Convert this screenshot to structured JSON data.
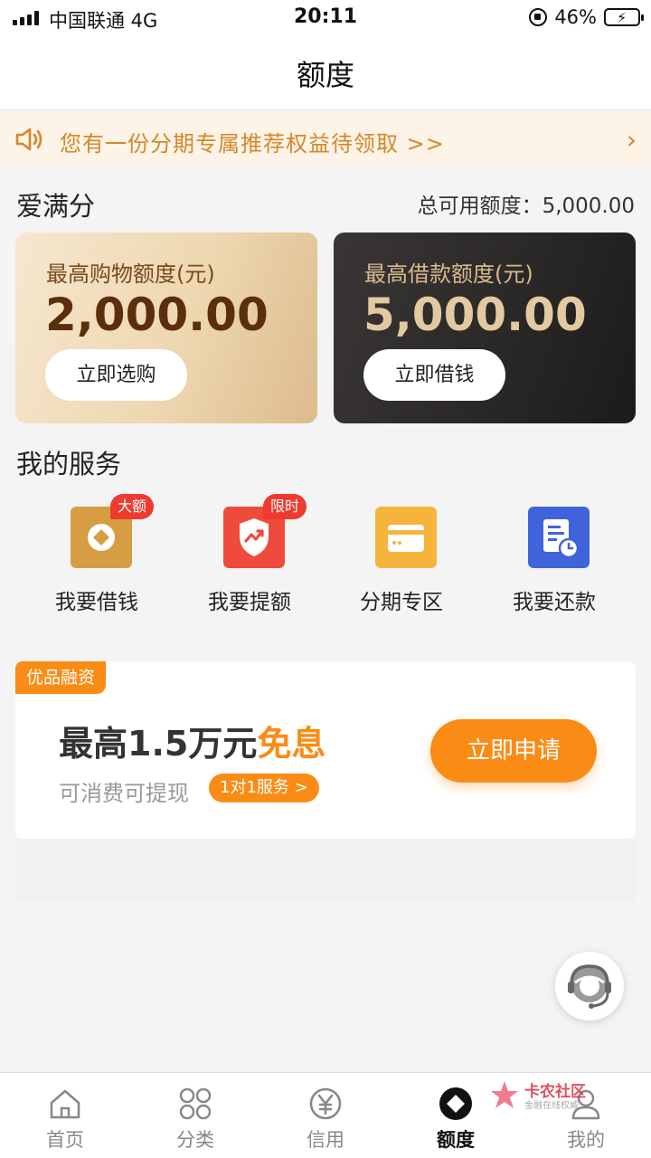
{
  "status_bar": {
    "carrier": "中国联通  4G",
    "time": "20:11",
    "battery": "46%"
  },
  "header": {
    "title": "额度"
  },
  "notice": {
    "text": "您有一份分期专属推荐权益待领取 >>"
  },
  "credit": {
    "section_title": "爱满分",
    "total_label": "总可用额度：5,000.00",
    "cards": [
      {
        "label": "最高购物额度(元)",
        "amount": "2,000.00",
        "button": "立即选购"
      },
      {
        "label": "最高借款额度(元)",
        "amount": "5,000.00",
        "button": "立即借钱"
      }
    ]
  },
  "services": {
    "section_title": "我的服务",
    "items": [
      {
        "label": "我要借钱",
        "badge": "大额",
        "icon": "loan-icon",
        "color": "#d79d42"
      },
      {
        "label": "我要提额",
        "badge": "限时",
        "icon": "raise-limit-icon",
        "color": "#ef4a3c"
      },
      {
        "label": "分期专区",
        "badge": "",
        "icon": "installment-card-icon",
        "color": "#f7b43c"
      },
      {
        "label": "我要还款",
        "badge": "",
        "icon": "repay-bill-icon",
        "color": "#3f63db"
      }
    ]
  },
  "promo": {
    "tag": "优品融资",
    "headline_prefix": "最高1.5万元",
    "headline_highlight": "免息",
    "subtitle": "可消费可提现",
    "pill": "1对1服务 >",
    "button": "立即申请"
  },
  "tabbar": {
    "items": [
      {
        "label": "首页",
        "icon": "home-icon"
      },
      {
        "label": "分类",
        "icon": "category-grid-icon"
      },
      {
        "label": "信用",
        "icon": "yen-coin-icon"
      },
      {
        "label": "额度",
        "icon": "quota-diamond-icon",
        "active": true
      },
      {
        "label": "我的",
        "icon": "profile-icon"
      }
    ]
  },
  "watermark": {
    "title": "卡农社区",
    "subtitle": "金融在线权威"
  },
  "colors": {
    "accent_orange": "#fa8c16",
    "notice_text": "#d4882b",
    "badge_red": "#ef3a2f"
  }
}
